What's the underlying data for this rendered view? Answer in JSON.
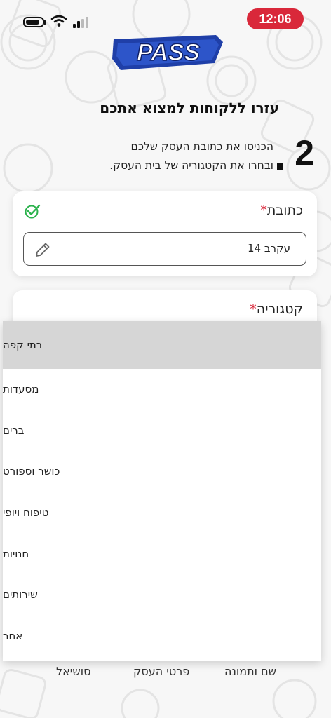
{
  "status_bar": {
    "time": "12:06",
    "battery_icon": "battery-icon",
    "wifi_icon": "wifi-icon",
    "signal_icon": "signal-icon",
    "accent_color": "#d9283a"
  },
  "logo": {
    "text": "PASS"
  },
  "heading": {
    "title": "עזרו ללקוחות למצוא אתכם"
  },
  "step": {
    "number": "2",
    "line1": "הכניסו את כתובת העסק שלכם",
    "line2": "ובחרו את הקטגוריה של בית העסק."
  },
  "address_field": {
    "label": "כתובת",
    "required_mark": "*",
    "value": "עקרב 14",
    "status_icon": "check-icon",
    "edit_icon": "pencil-icon"
  },
  "category_field": {
    "label": "קטגוריה",
    "required_mark": "*"
  },
  "dropdown": {
    "selected_index": 0,
    "options": [
      "בתי קפה",
      "מסעדות",
      "ברים",
      "כושר וספורט",
      "טיפוח ויופי",
      "חנויות",
      "שירותים",
      "אחר"
    ]
  },
  "bottom_tabs": [
    "שם ותמונה",
    "פרטי העסק",
    "סושיאל"
  ]
}
